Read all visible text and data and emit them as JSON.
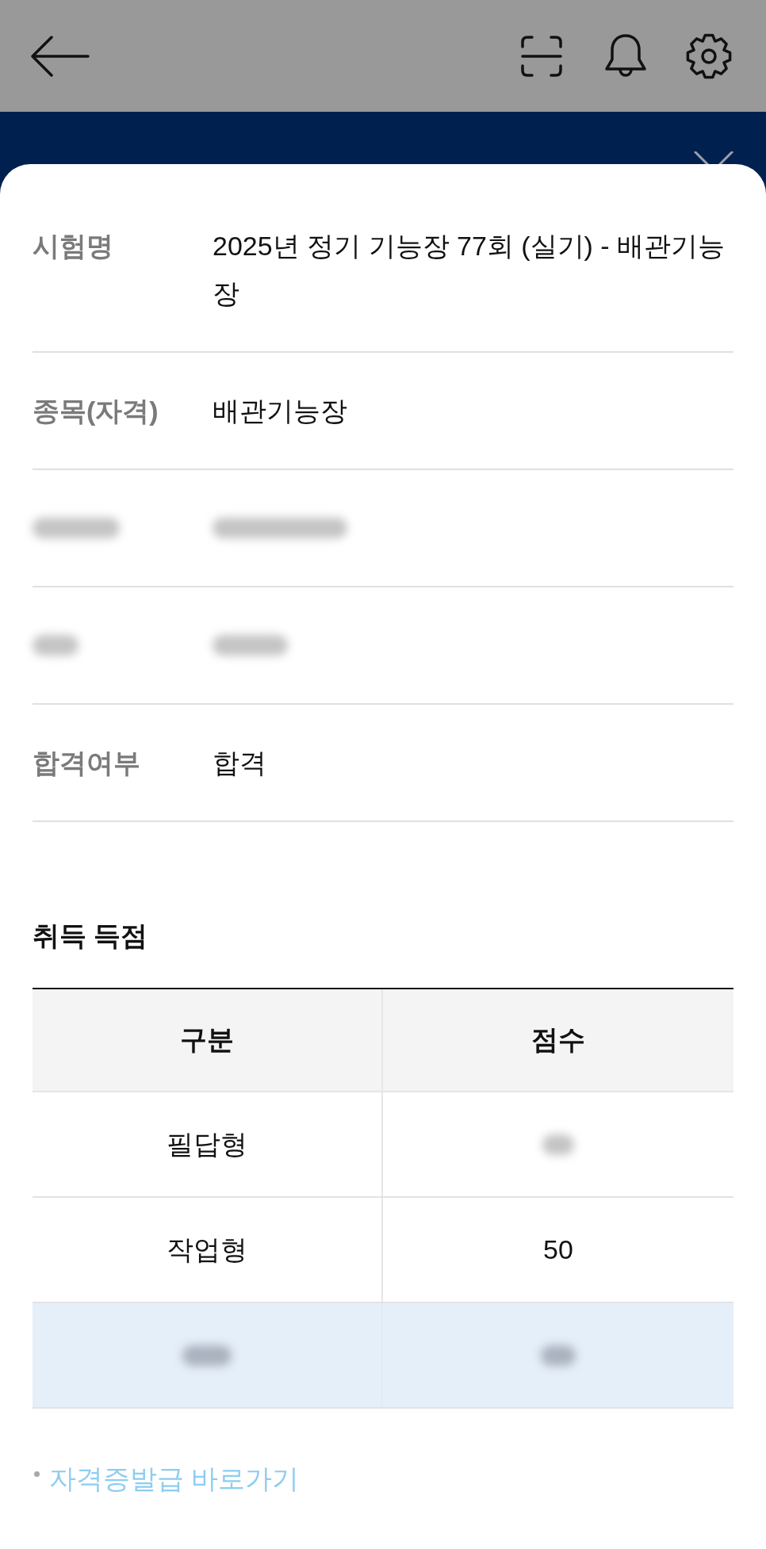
{
  "info_rows": [
    {
      "kind": "text",
      "label": "시험명",
      "value": "2025년 정기 기능장 77회 (실기) - 배관기능장"
    },
    {
      "kind": "text",
      "label": "종목(자격)",
      "value": "배관기능장"
    },
    {
      "kind": "redacted"
    },
    {
      "kind": "redacted"
    },
    {
      "kind": "text",
      "label": "합격여부",
      "value": "합격"
    }
  ],
  "score_section": {
    "title": "취득 득점",
    "columns": [
      "구분",
      "점수"
    ],
    "rows": [
      {
        "highlighted": false,
        "cells": [
          {
            "kind": "text",
            "text": "필답형"
          },
          {
            "kind": "redacted"
          }
        ]
      },
      {
        "highlighted": false,
        "cells": [
          {
            "kind": "text",
            "text": "작업형"
          },
          {
            "kind": "text",
            "text": "50"
          }
        ]
      },
      {
        "highlighted": true,
        "cells": [
          {
            "kind": "redacted"
          },
          {
            "kind": "redacted"
          }
        ]
      }
    ]
  },
  "link": {
    "text": "자격증발급 바로가기"
  }
}
